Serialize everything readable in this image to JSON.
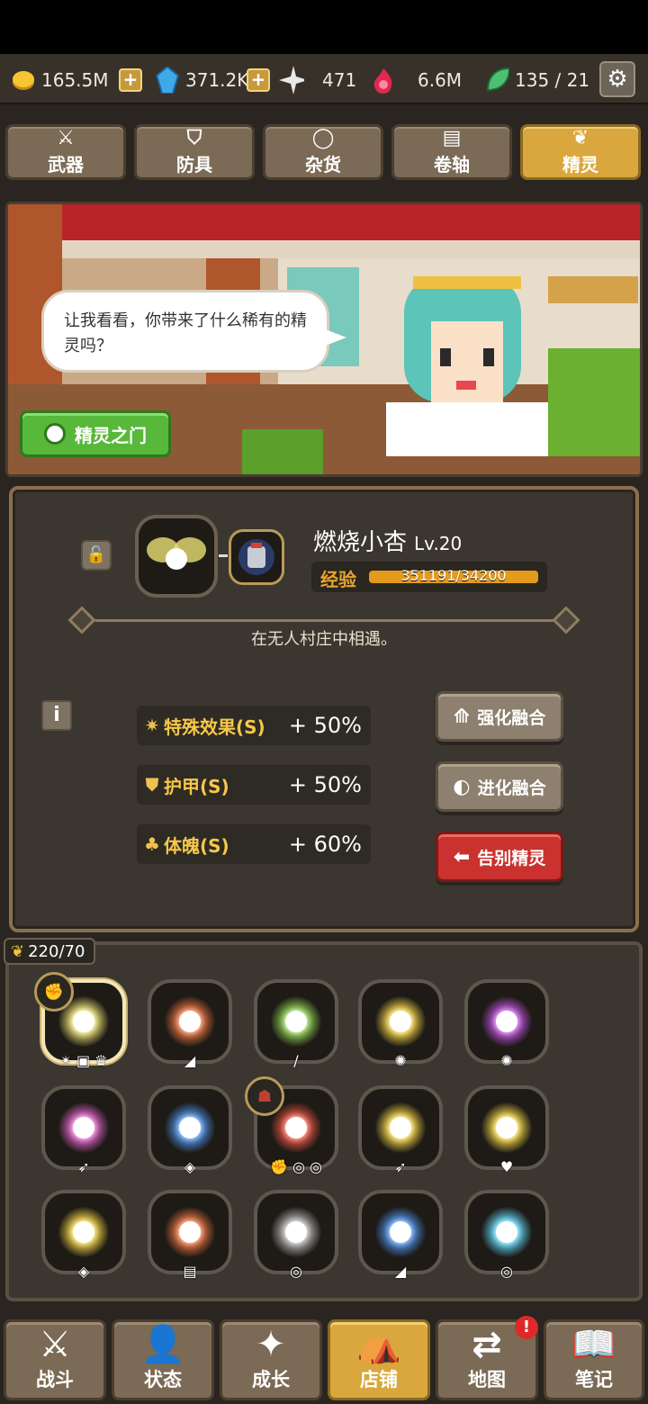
{
  "resources": {
    "gold": "165.5M",
    "gems": "371.2K",
    "shards": "471",
    "essence": "6.6M",
    "energy": "135 / 21"
  },
  "tabs": [
    {
      "label": "武器",
      "icon": "sword-icon"
    },
    {
      "label": "防具",
      "icon": "shield-icon"
    },
    {
      "label": "杂货",
      "icon": "ring-icon"
    },
    {
      "label": "卷轴",
      "icon": "scroll-icon"
    },
    {
      "label": "精灵",
      "icon": "wings-icon",
      "active": true
    }
  ],
  "scene": {
    "speech": "让我看看，你带来了什么稀有的精灵吗？",
    "gate_button": "精灵之门"
  },
  "spirit": {
    "name": "燃烧小杏",
    "level": "Lv.20",
    "exp_label": "经验",
    "exp_value": "351191/34200",
    "description": "在无人村庄中相遇。",
    "stats": [
      {
        "label": "特殊效果(S)",
        "value": "+ 50%",
        "icon": "sparkle-icon"
      },
      {
        "label": "护甲(S)",
        "value": "+ 50%",
        "icon": "armor-icon"
      },
      {
        "label": "体魄(S)",
        "value": "+ 60%",
        "icon": "muscle-icon"
      }
    ],
    "actions": {
      "enhance": "强化融合",
      "evolve": "进化融合",
      "farewell": "告别精灵"
    }
  },
  "inventory": {
    "count": "220/70",
    "colors": [
      "#e8e070",
      "#e8703c",
      "#8ed050",
      "#f0d040",
      "#c050e0",
      "#e060c8",
      "#4a90e8",
      "#e85040",
      "#f0d040",
      "#f0d040",
      "#f0d040",
      "#e8703c",
      "#b0b0b0",
      "#4a90e8",
      "#5ad0f0"
    ],
    "tags": [
      "✴ ▣ ♛",
      "◢",
      "/",
      "✺",
      "✺",
      "➶",
      "◈",
      "✊ ◎ ◎",
      "➶",
      "♥",
      "◈",
      "▤",
      "◎",
      "◢",
      "◎"
    ]
  },
  "nav": [
    {
      "label": "战斗",
      "icon": "crossed-swords-icon"
    },
    {
      "label": "状态",
      "icon": "person-icon"
    },
    {
      "label": "成长",
      "icon": "star-icon"
    },
    {
      "label": "店铺",
      "icon": "tent-icon",
      "active": true
    },
    {
      "label": "地图",
      "icon": "signpost-icon",
      "alert": "!"
    },
    {
      "label": "笔记",
      "icon": "book-icon"
    }
  ]
}
